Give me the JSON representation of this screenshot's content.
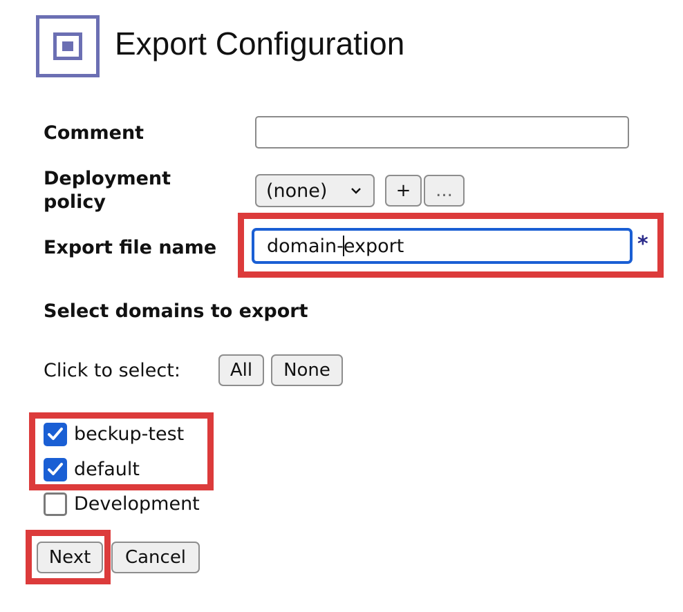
{
  "page": {
    "title": "Export Configuration"
  },
  "form": {
    "comment_label": "Comment",
    "comment_value": "",
    "deployment_policy_label_line1": "Deployment",
    "deployment_policy_label_line2": "policy",
    "deployment_policy_value": "(none)",
    "add_label": "+",
    "more_label": "...",
    "export_file_name_label": "Export file name",
    "export_file_name_before_caret": "domain-",
    "export_file_name_after_caret": "export",
    "required_marker": "*"
  },
  "domains": {
    "heading": "Select domains to export",
    "click_to_select_label": "Click to select:",
    "all_label": "All",
    "none_label": "None",
    "items": [
      {
        "label": "beckup-test",
        "checked": true
      },
      {
        "label": "default",
        "checked": true
      },
      {
        "label": "Development",
        "checked": false
      }
    ]
  },
  "actions": {
    "next_label": "Next",
    "cancel_label": "Cancel"
  },
  "colors": {
    "highlight": "#dc3b3b",
    "accent": "#1a5fd4",
    "logo": "#6b6fb3"
  },
  "icons": {
    "logo": "square-in-square-icon",
    "dropdown": "chevron-down-icon",
    "check": "checkmark-icon"
  }
}
